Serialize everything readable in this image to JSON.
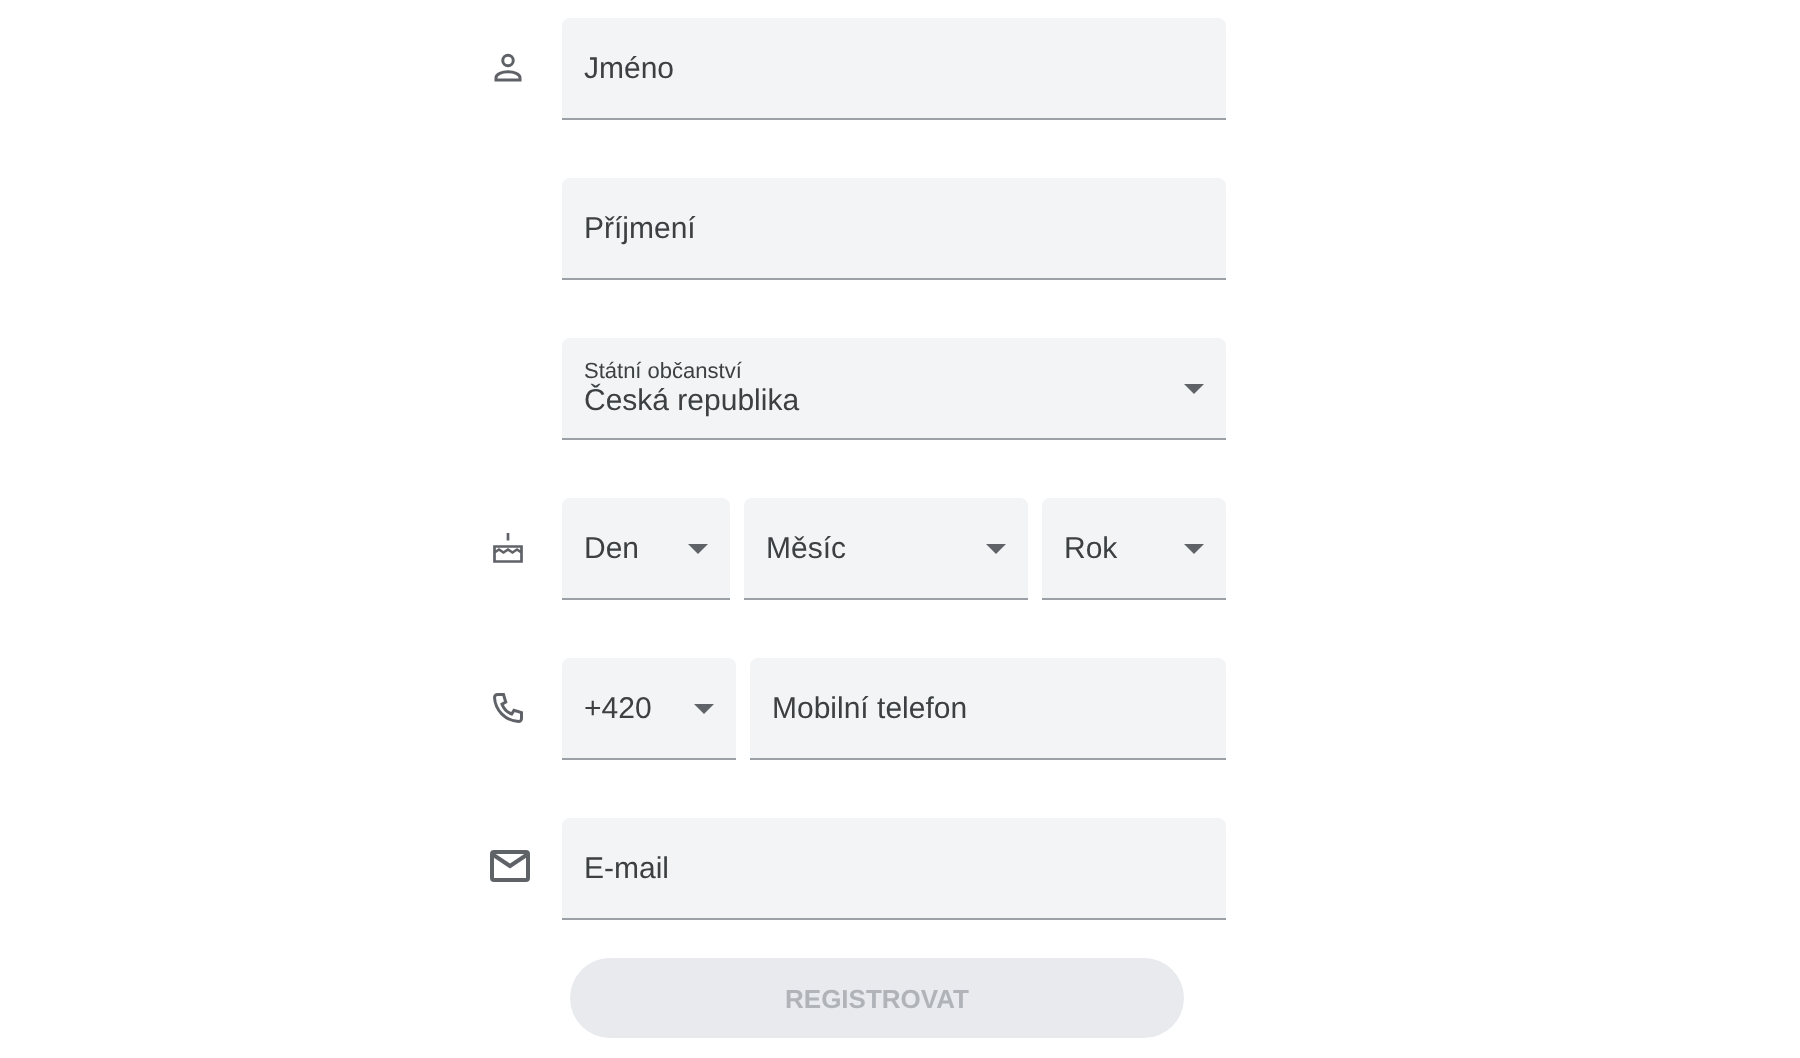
{
  "rows": [
    {
      "kind": "person",
      "fields": [
        {
          "kind": "text",
          "placeholder": "Jméno"
        }
      ]
    },
    {
      "kind": "none",
      "fields": [
        {
          "kind": "text",
          "placeholder": "Příjmení"
        }
      ]
    },
    {
      "kind": "none",
      "fields": [
        {
          "kind": "select",
          "label": "Státní občanství",
          "value": "Česká republika"
        }
      ]
    },
    {
      "kind": "cake",
      "fields": [
        {
          "kind": "select",
          "value": "Den"
        },
        {
          "kind": "select",
          "value": "Měsíc"
        },
        {
          "kind": "select",
          "value": "Rok"
        }
      ]
    },
    {
      "kind": "phone",
      "fields": [
        {
          "kind": "select",
          "value": "+420"
        },
        {
          "kind": "text",
          "placeholder": "Mobilní telefon"
        }
      ]
    },
    {
      "kind": "mail",
      "fields": [
        {
          "kind": "text",
          "placeholder": "E-mail"
        }
      ]
    }
  ],
  "submit": {
    "label": "REGISTROVAT",
    "disabled": true
  }
}
